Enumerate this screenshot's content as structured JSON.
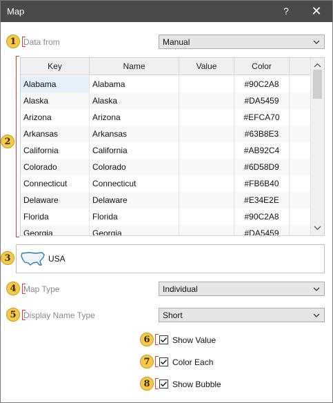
{
  "window": {
    "title": "Map",
    "help_glyph": "?",
    "close_glyph": "✕"
  },
  "markers": [
    "1",
    "2",
    "3",
    "4",
    "5",
    "6",
    "7",
    "8"
  ],
  "data_from": {
    "label": "Data from",
    "value": "Manual"
  },
  "grid": {
    "headers": [
      "Key",
      "Name",
      "Value",
      "Color"
    ],
    "rows": [
      {
        "key": "Alabama",
        "name": "Alabama",
        "value": "",
        "color": "#90C2A8"
      },
      {
        "key": "Alaska",
        "name": "Alaska",
        "value": "",
        "color": "#DA5459"
      },
      {
        "key": "Arizona",
        "name": "Arizona",
        "value": "",
        "color": "#EFCA70"
      },
      {
        "key": "Arkansas",
        "name": "Arkansas",
        "value": "",
        "color": "#63B8E3"
      },
      {
        "key": "California",
        "name": "California",
        "value": "",
        "color": "#AB92C4"
      },
      {
        "key": "Colorado",
        "name": "Colorado",
        "value": "",
        "color": "#6D58D9"
      },
      {
        "key": "Connecticut",
        "name": "Connecticut",
        "value": "",
        "color": "#FB6B40"
      },
      {
        "key": "Delaware",
        "name": "Delaware",
        "value": "",
        "color": "#E34E2E"
      },
      {
        "key": "Florida",
        "name": "Florida",
        "value": "",
        "color": "#90C2A8"
      },
      {
        "key": "Georgia",
        "name": "Georgia",
        "value": "",
        "color": "#DA5459"
      }
    ]
  },
  "map": {
    "label": "USA",
    "icon": "usa-map-icon"
  },
  "map_type": {
    "label": "Map Type",
    "value": "Individual"
  },
  "display_name_type": {
    "label": "Display Name Type",
    "value": "Short"
  },
  "options": {
    "show_value": {
      "label": "Show Value",
      "checked": true
    },
    "color_each": {
      "label": "Color Each",
      "checked": true
    },
    "show_bubble": {
      "label": "Show Bubble",
      "checked": true
    }
  },
  "colors": {
    "titlebar": "#4a4a4a",
    "marker": "#f7c948",
    "bracket": "#d83a3a",
    "selection": "#e5f0fb",
    "map_icon": "#2a7ab8"
  }
}
